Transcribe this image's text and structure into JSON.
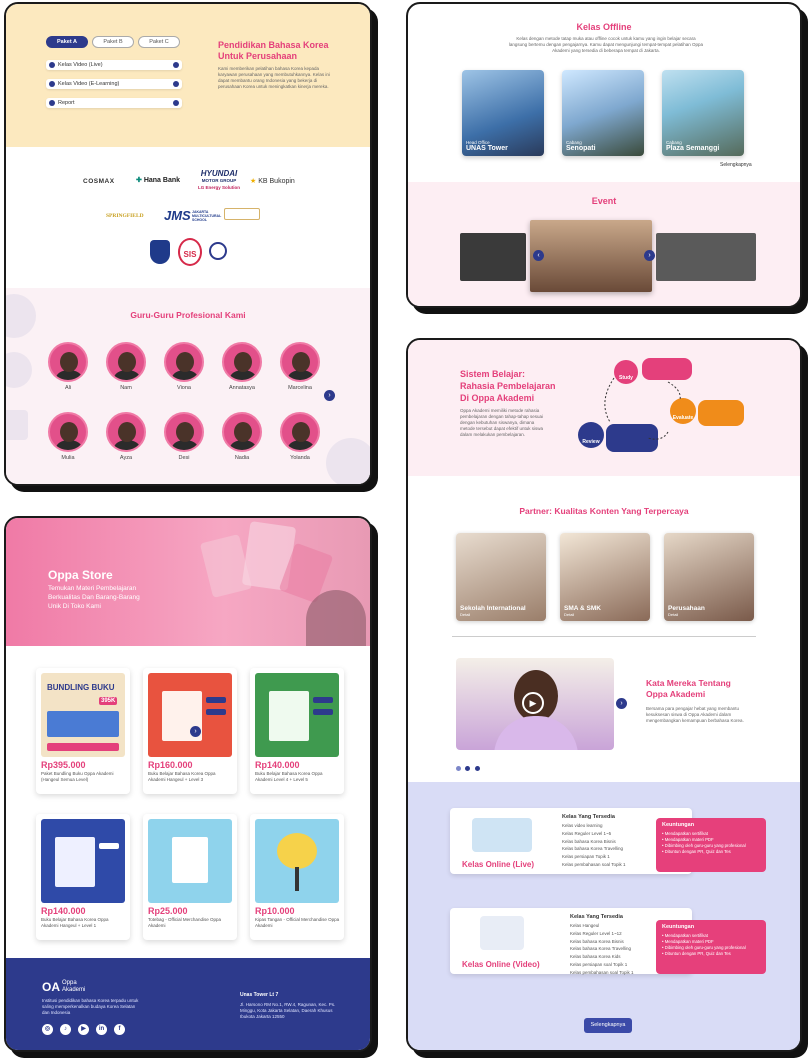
{
  "company": {
    "packages": [
      "Paket A",
      "Paket B",
      "Paket C"
    ],
    "accordion": [
      "Kelas Video (Live)",
      "Kelas Video (E-Learning)",
      "Report"
    ],
    "title_line1": "Pendidikan Bahasa Korea",
    "title_line2": "Untuk Perusahaan",
    "desc": "Kami memberikan pelatihan bahasa Korea kepada karyawan perusahaan yang membutuhkannya. Kelas ini dapat membantu orang Indonesia yang bekerja di perusahaan Korea untuk meningkatkan kinerja mereka."
  },
  "logos": [
    "COSMAX",
    "Hana Bank",
    "HYUNDAI",
    "MOTOR GROUP",
    "LG Energy Solution",
    "KB Bukopin",
    "SPRINGFIELD",
    "JMS",
    "JAKARTA MULTICULTURAL SCHOOL",
    "SIS"
  ],
  "gurus": {
    "title": "Guru-Guru Profesional Kami",
    "row1": [
      "Ali",
      "Nam",
      "Viona",
      "Annatasya",
      "Marcelina"
    ],
    "row2": [
      "Mulia",
      "Ayza",
      "Desi",
      "Nadia",
      "Yolanda"
    ]
  },
  "store": {
    "title": "Oppa Store",
    "subtitle_line1": "Temukan Materi Pembelajaran",
    "subtitle_line2": "Berkualitas Dan Barang-Barang",
    "subtitle_line3": "Unik Di Toko Kami",
    "products": [
      {
        "price": "Rp395.000",
        "desc": "Paket Bundling Buku Oppa Akademi (Hangeul Semua Level)",
        "color": "#f3e3c6"
      },
      {
        "price": "Rp160.000",
        "desc": "Buku Belajar Bahasa Korea Oppa Akademi Hangeul + Level 3",
        "color": "#e8533f"
      },
      {
        "price": "Rp140.000",
        "desc": "Buku Belajar Bahasa Korea Oppa Akademi Level 4 + Level 5",
        "color": "#3f9a4f"
      },
      {
        "price": "Rp140.000",
        "desc": "Buku Belajar Bahasa Korea Oppa Akademi Hangeul + Level 1",
        "color": "#2f4aa8"
      },
      {
        "price": "Rp25.000",
        "desc": "Totebag - Official Merchandise Oppa Akademi",
        "color": "#8fd3ec"
      },
      {
        "price": "Rp10.000",
        "desc": "Kipas Tangan - Official Merchandise Oppa Akademi",
        "color": "#8fd3ec"
      }
    ]
  },
  "promo": {
    "book_title": "BUNDLING BUKU",
    "price_tag": "395K"
  },
  "footer": {
    "brand1": "Oppa",
    "brand2": "Akademi",
    "desc": "Institusi pendidikan bahasa Korea terpadu untuk saling memperkenalkan budaya Korea Selatan dan Indonesia",
    "office_title": "Unas Tower Lt 7",
    "office_addr": "Jl. Harsono RM No.1, RW.4, Ragunan, Kec. Ps. Minggu, Kota Jakarta Selatan, Daerah Khusus Ibukota Jakarta 12550",
    "socials": [
      "ig",
      "tt",
      "yt",
      "in",
      "fb"
    ]
  },
  "offline": {
    "title": "Kelas Offline",
    "desc": "Kelas dengan metode tatap muka atau offline cocok untuk kamu yang ingin belajar secara langsung bertemu dengan pengajarnya. Kamu dapat mengunjungi tempat-tempat pelatihan Oppa Akademi yang tersedia di beberapa tempat di Jakarta.",
    "locations": [
      {
        "type": "Head Office",
        "name": "UNAS Tower"
      },
      {
        "type": "Cabang",
        "name": "Senopati"
      },
      {
        "type": "Cabang",
        "name": "Plaza Semanggi"
      }
    ],
    "more": "Selengkapnya",
    "event_title": "Event"
  },
  "sistem": {
    "title_line1": "Sistem Belajar:",
    "title_line2": "Rahasia Pembelajaran",
    "title_line3": "Di Oppa Akademi",
    "desc": "Oppa Akademi memiliki metode rahasia pembelajaran dengan tahap-tahap sesuai dengan kebutuhan siswanya, dimana metode tersebut dapat efektif untuk siswa dalam melakukan pembelajaran.",
    "steps": [
      "Study",
      "Evaluate",
      "Review"
    ],
    "partner_title": "Partner: Kualitas Konten Yang Terpercaya",
    "partners": [
      {
        "name": "Sekolah International",
        "sub": "Detail"
      },
      {
        "name": "SMA & SMK",
        "sub": "Detail"
      },
      {
        "name": "Perusahaan",
        "sub": "Detail"
      }
    ],
    "testi_title_line1": "Kata Mereka Tentang",
    "testi_title_line2": "Oppa Akademi",
    "testi_desc": "Bersama para pengajar hebat yang membantu kesuksesan siswa di Oppa Akademi dalam mengembangkan kemampuan berbahasa Korea."
  },
  "online": {
    "live": {
      "title": "Kelas Online (Live)",
      "list_title": "Kelas Yang Tersedia",
      "items": [
        "Kelas video learning",
        "Kelas Reguler Level 1~5",
        "Kelas bahasa Korea Bisnis",
        "Kelas bahasa Korea Travelling",
        "Kelas persiapan Topik 1",
        "Kelas pembahasan soal Topik 1"
      ]
    },
    "video": {
      "title": "Kelas Online (Video)",
      "list_title": "Kelas Yang Tersedia",
      "items": [
        "Kelas Hangeul",
        "Kelas Reguler Level 1~12",
        "Kelas bahasa Korea Bisnis",
        "Kelas bahasa Korea Travelling",
        "Kelas bahasa Korea Kids",
        "Kelas persiapan soal Topik 1",
        "Kelas pembahasan soal Topik 1"
      ]
    },
    "benefit_title": "Keuntungan",
    "benefits": [
      "Mendapatkan sertifikat",
      "Mendapatkan materi PDF",
      "Dibimbing oleh guru-guru yang profesional",
      "Dituntun dengan PR, Quiz dan Tes"
    ],
    "more": "Selengkapnya"
  }
}
